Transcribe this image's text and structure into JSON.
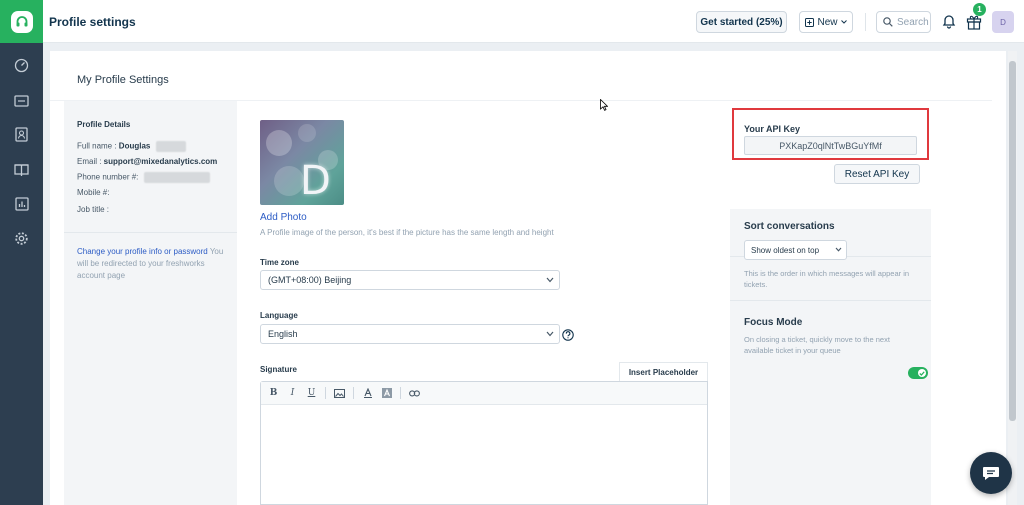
{
  "colors": {
    "brand_green": "#27b15f",
    "nav_bg": "#2d3e50",
    "link_blue": "#2c5cc5",
    "highlight_red": "#e0393e"
  },
  "nav": {
    "logo_icon": "freshdesk-headset-logo",
    "items": [
      {
        "icon": "dashboard-icon"
      },
      {
        "icon": "tickets-icon"
      },
      {
        "icon": "contacts-icon"
      },
      {
        "icon": "knowledge-base-icon"
      },
      {
        "icon": "reports-icon"
      },
      {
        "icon": "admin-gear-icon"
      }
    ]
  },
  "header": {
    "title": "Profile settings",
    "get_started": "Get started (25%)",
    "new_label": "New",
    "search_placeholder": "Search",
    "gift_badge": "1",
    "avatar_initial": "D"
  },
  "page": {
    "title": "My Profile Settings"
  },
  "profile": {
    "heading": "Profile Details",
    "full_name_label": "Full name : ",
    "full_name_value": "Douglas",
    "email_label": "Email : ",
    "email_value": "support@mixedanalytics.com",
    "phone_label": "Phone number #:",
    "mobile_label": "Mobile #:",
    "job_title_label": "Job title :",
    "note_link": "Change your profile info or password",
    "note_text": " You will be redirected to your freshworks account page"
  },
  "photo": {
    "initial": "D",
    "add_label": "Add Photo",
    "hint": "A Profile image of the person, it's best if the picture has the same length and height"
  },
  "timezone": {
    "label": "Time zone",
    "value": "(GMT+08:00) Beijing"
  },
  "language": {
    "label": "Language",
    "value": "English"
  },
  "signature": {
    "label": "Signature",
    "insert_placeholder": "Insert Placeholder",
    "toolbar": [
      "B",
      "I",
      "U"
    ]
  },
  "api": {
    "label": "Your API Key",
    "key": "PXKapZ0qlNtTwBGuYfMf",
    "reset_label": "Reset API Key"
  },
  "sort": {
    "heading": "Sort conversations",
    "value": "Show oldest on top",
    "desc": "This is the order in which messages will appear in tickets."
  },
  "focus": {
    "heading": "Focus Mode",
    "desc": "On closing a ticket, quickly move to the next available ticket in your queue",
    "enabled": true
  }
}
